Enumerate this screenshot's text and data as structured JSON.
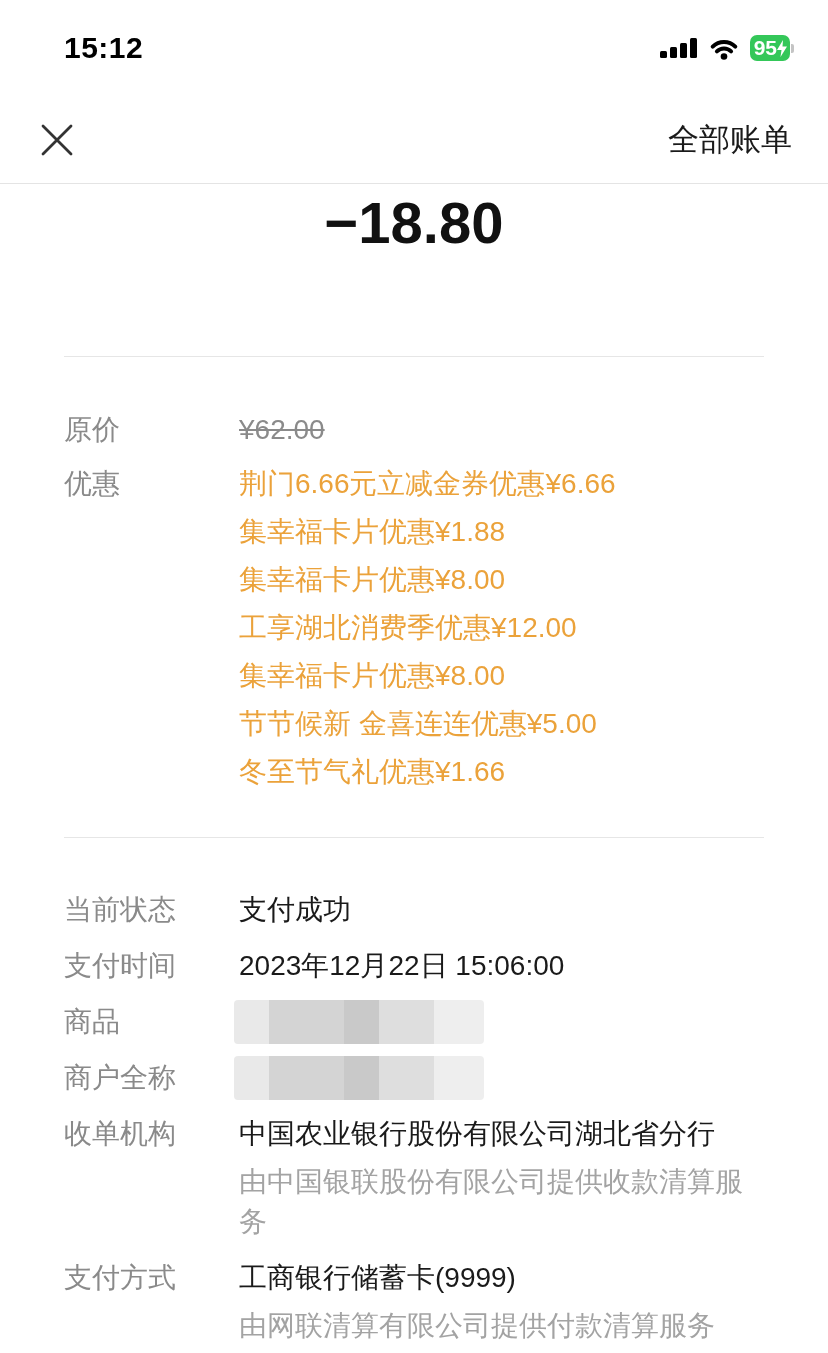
{
  "status_bar": {
    "time": "15:12",
    "battery": "95"
  },
  "nav_bar": {
    "action": "全部账单"
  },
  "amount": "−18.80",
  "price_section": {
    "rows": [
      {
        "kind": "original",
        "label": "原价",
        "value": "¥62.00",
        "struck": true
      },
      {
        "kind": "discounts",
        "label": "优惠",
        "items": [
          "荆门6.66元立减金券优惠¥6.66",
          "集幸福卡片优惠¥1.88",
          "集幸福卡片优惠¥8.00",
          "工享湖北消费季优惠¥12.00",
          "集幸福卡片优惠¥8.00",
          "节节候新 金喜连连优惠¥5.00",
          "冬至节气礼优惠¥1.66"
        ]
      }
    ]
  },
  "details": [
    {
      "label": "当前状态",
      "value": "支付成功"
    },
    {
      "label": "支付时间",
      "value": "2023年12月22日 15:06:00"
    },
    {
      "label": "商品",
      "redacted": true
    },
    {
      "label": "商户全称",
      "redacted": true
    },
    {
      "label": "收单机构",
      "value": "中国农业银行股份有限公司湖北省分行",
      "note": "由中国银联股份有限公司提供收款清算服务"
    },
    {
      "label": "支付方式",
      "value": "工商银行储蓄卡(9999)",
      "note": "由网联清算有限公司提供付款清算服务"
    }
  ]
}
